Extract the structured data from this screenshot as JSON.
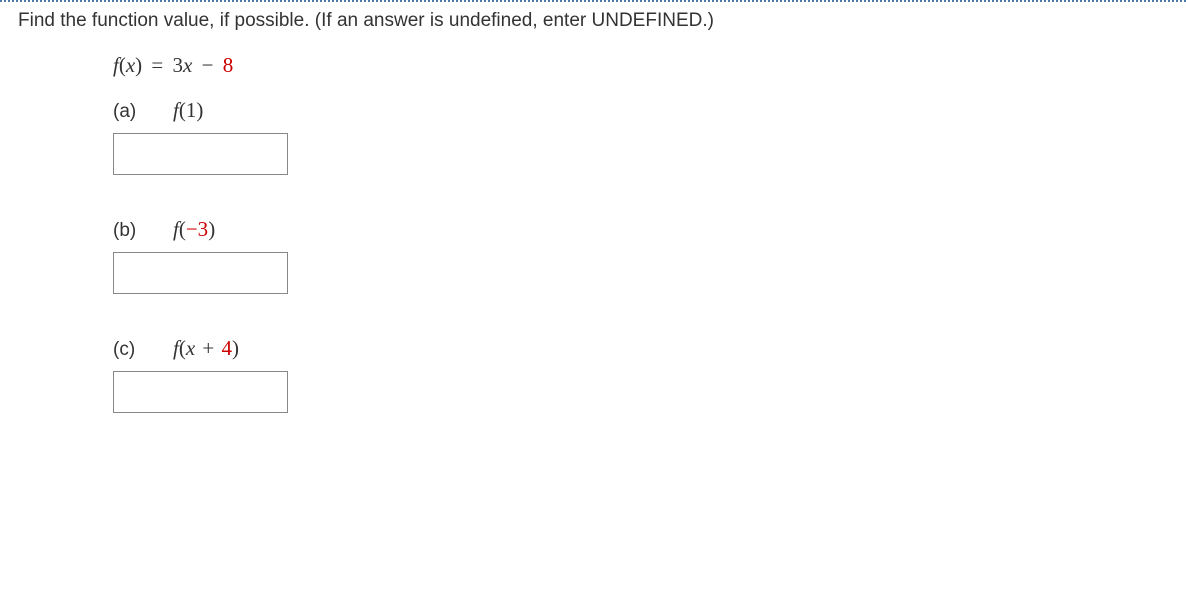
{
  "instruction": "Find the function value, if possible. (If an answer is undefined, enter UNDEFINED.)",
  "function": {
    "lhs_fn": "f",
    "lhs_var": "x",
    "rhs_coef": "3",
    "rhs_var": "x",
    "rhs_op": "−",
    "rhs_const": "8"
  },
  "parts": {
    "a": {
      "label": "(a)",
      "fn": "f",
      "arg": "1",
      "arg_red": false,
      "answer": ""
    },
    "b": {
      "label": "(b)",
      "fn": "f",
      "arg": "−3",
      "arg_red": true,
      "answer": ""
    },
    "c": {
      "label": "(c)",
      "fn": "f",
      "arg_var": "x",
      "arg_op": "+",
      "arg_const": "4",
      "arg_const_red": true,
      "answer": ""
    }
  }
}
